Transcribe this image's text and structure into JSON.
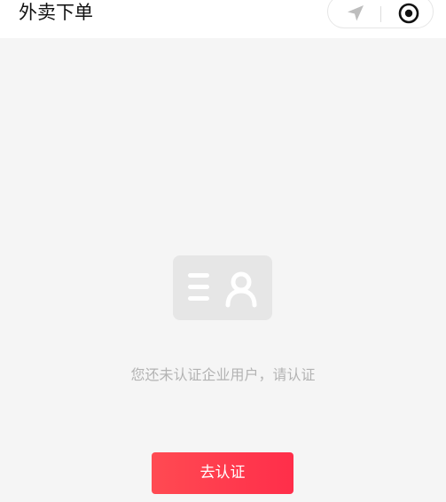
{
  "header": {
    "title": "外卖下单",
    "icons": [
      "navigation-arrow-icon",
      "target-icon"
    ]
  },
  "empty_state": {
    "icon": "id-card-icon",
    "message": "您还未认证企业用户，请认证"
  },
  "actions": {
    "verify_label": "去认证"
  },
  "colors": {
    "accent": "#ff3a4e",
    "background": "#f5f5f5",
    "message_text": "#b3b3b3"
  }
}
